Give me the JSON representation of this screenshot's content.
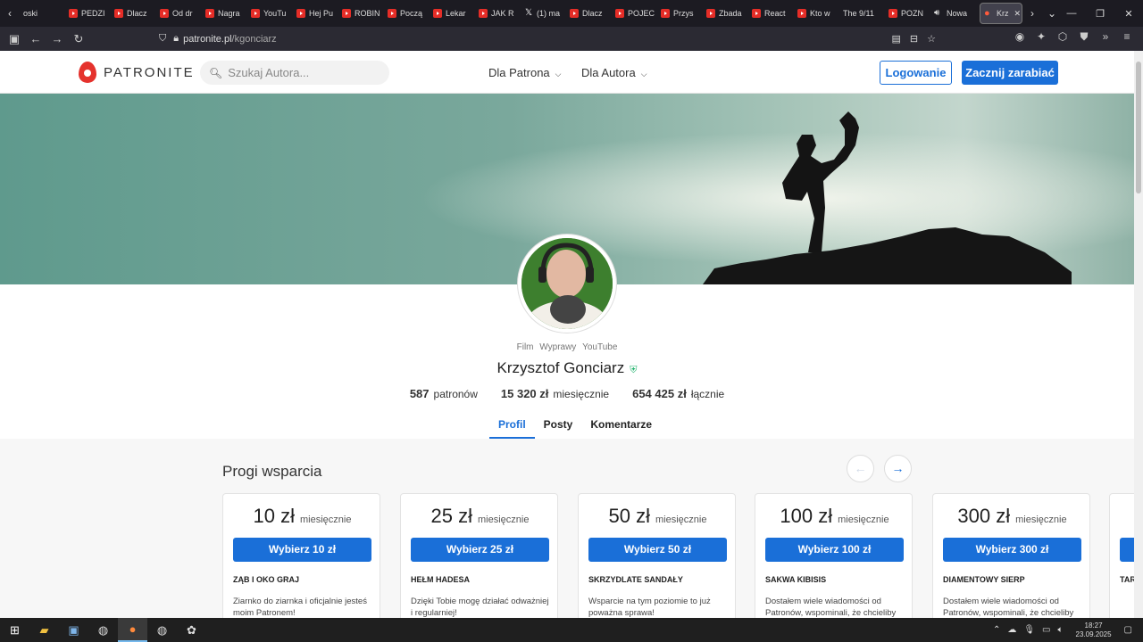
{
  "browser": {
    "tabs": [
      {
        "label": "oski",
        "icon": "none"
      },
      {
        "label": "PEDZI",
        "icon": "yt"
      },
      {
        "label": "Dlacz",
        "icon": "yt"
      },
      {
        "label": "Od dr",
        "icon": "yt"
      },
      {
        "label": "Nagra",
        "icon": "yt"
      },
      {
        "label": "YouTu",
        "icon": "yt"
      },
      {
        "label": "Hej Pu",
        "icon": "yt"
      },
      {
        "label": "ROBIN",
        "icon": "yt"
      },
      {
        "label": "Począ",
        "icon": "yt"
      },
      {
        "label": "Lekar",
        "icon": "yt"
      },
      {
        "label": "JAK R",
        "icon": "yt"
      },
      {
        "label": "(1) ma",
        "icon": "x"
      },
      {
        "label": "Dlacz",
        "icon": "yt"
      },
      {
        "label": "POJEC",
        "icon": "yt"
      },
      {
        "label": "Przys",
        "icon": "yt"
      },
      {
        "label": "Zbada",
        "icon": "yt"
      },
      {
        "label": "React",
        "icon": "yt"
      },
      {
        "label": "Kto w",
        "icon": "yt"
      },
      {
        "label": "The 9/11",
        "icon": "none"
      },
      {
        "label": "POZN",
        "icon": "yt"
      },
      {
        "label": "Nowa",
        "icon": "speaker"
      },
      {
        "label": "Krz",
        "icon": "patronite",
        "active": true
      }
    ],
    "url_host": "patronite.pl",
    "url_path": "/kgonciarz"
  },
  "header": {
    "logo_text": "PATRONITE",
    "search_placeholder": "Szukaj Autora...",
    "menu_patron": "Dla Patrona",
    "menu_author": "Dla Autora",
    "login_label": "Logowanie",
    "start_label": "Zacznij zarabiać"
  },
  "profile": {
    "tags": [
      "Film",
      "Wyprawy",
      "YouTube"
    ],
    "name": "Krzysztof Gonciarz",
    "stats": [
      {
        "value": "587",
        "label": "patronów"
      },
      {
        "value": "15 320 zł",
        "label": "miesięcznie"
      },
      {
        "value": "654 425 zł",
        "label": "łącznie"
      }
    ],
    "tabs": [
      "Profil",
      "Posty",
      "Komentarze"
    ],
    "active_tab": "Profil"
  },
  "tiers": {
    "title": "Progi wsparcia",
    "items": [
      {
        "amount": "10 zł",
        "per": "miesięcznie",
        "button": "Wybierz 10 zł",
        "name": "ZĄB I OKO GRAJ",
        "desc": "Ziarnko do ziarnka i oficjalnie jesteś moim Patronem!"
      },
      {
        "amount": "25 zł",
        "per": "miesięcznie",
        "button": "Wybierz 25 zł",
        "name": "HEŁM HADESA",
        "desc": "Dzięki Tobie mogę działać odważniej i regularniej!"
      },
      {
        "amount": "50 zł",
        "per": "miesięcznie",
        "button": "Wybierz 50 zł",
        "name": "SKRZYDLATE SANDAŁY",
        "desc": "Wsparcie na tym poziomie to już poważna sprawa!"
      },
      {
        "amount": "100 zł",
        "per": "miesięcznie",
        "button": "Wybierz 100 zł",
        "name": "SAKWA KIBISIS",
        "desc": "Dostałem wiele wiadomości od Patronów, wspominali, że chcieliby"
      },
      {
        "amount": "300 zł",
        "per": "miesięcznie",
        "button": "Wybierz 300 zł",
        "name": "DIAMENTOWY SIERP",
        "desc": "Dostałem wiele wiadomości od Patronów, wspominali, że chcieliby"
      },
      {
        "amount": "",
        "per": "",
        "button": "",
        "name": "TAR",
        "desc": ""
      }
    ]
  },
  "taskbar": {
    "time": "18:27",
    "date": "23.09.2025"
  },
  "colors": {
    "accent": "#1a6fd8",
    "brand": "#e5322d",
    "verified": "#2bb673"
  }
}
